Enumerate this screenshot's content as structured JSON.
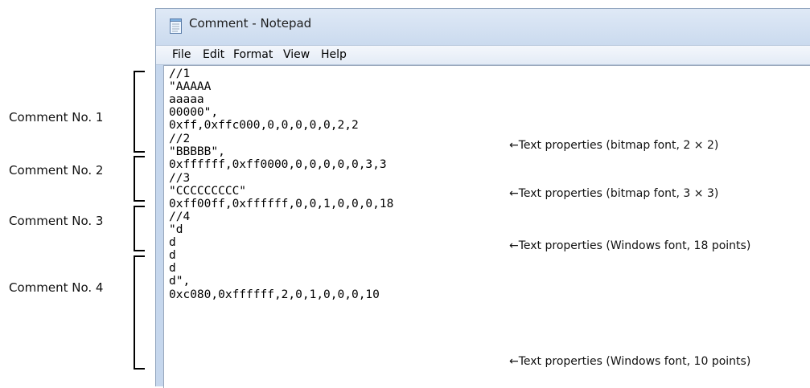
{
  "window": {
    "title": "Comment - Notepad"
  },
  "menu": [
    "File",
    "Edit",
    "Format",
    "View",
    "Help"
  ],
  "editor_lines": [
    "//1",
    "\"AAAAA",
    "aaaaa",
    "00000\",",
    "0xff,0xffc000,0,0,0,0,0,2,2",
    "//2",
    "\"BBBBB\",",
    "0xffffff,0xff0000,0,0,0,0,0,3,3",
    "//3",
    "\"CCCCCCCCC\"",
    "0xff00ff,0xffffff,0,0,1,0,0,0,18",
    "//4",
    "\"d",
    "d",
    "d",
    "d",
    "d\",",
    "0xc080,0xffffff,2,0,1,0,0,0,10"
  ],
  "comment_labels": [
    "Comment No. 1",
    "Comment No. 2",
    "Comment No. 3",
    "Comment No. 4"
  ],
  "annotations": [
    "←Text properties (bitmap font, 2 × 2)",
    "←Text properties (bitmap font, 3 × 3)",
    "←Text properties (Windows font, 18 points)",
    "←Text properties (Windows font, 10 points)"
  ]
}
